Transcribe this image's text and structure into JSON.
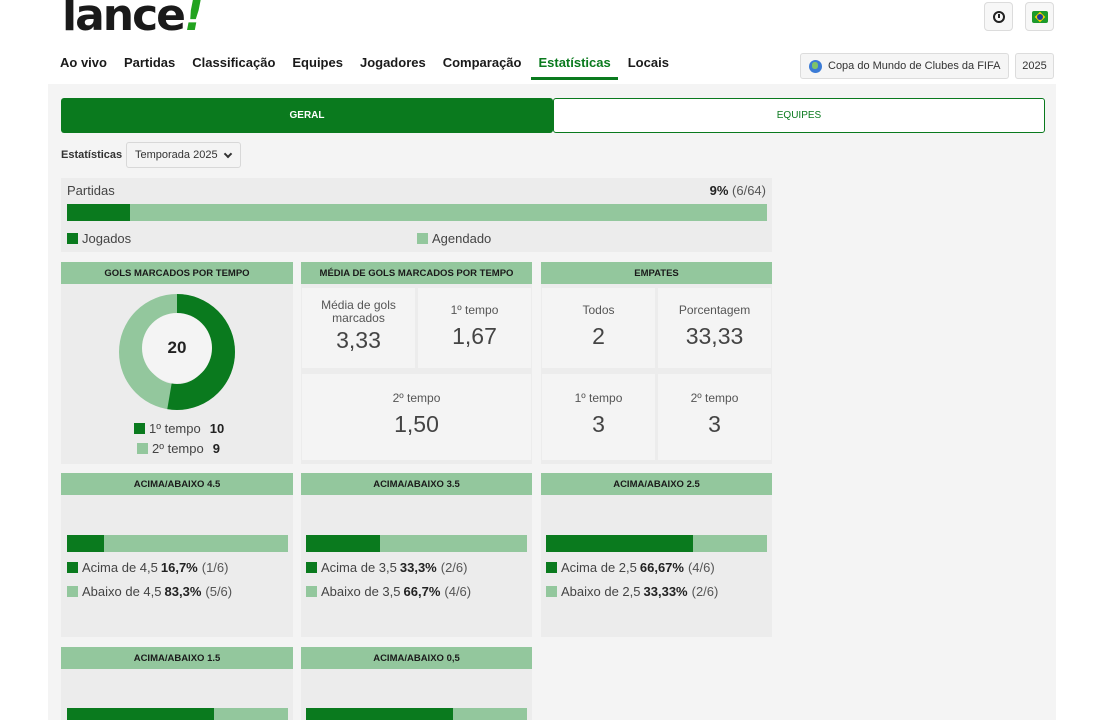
{
  "brand": {
    "logo_text": "lance",
    "logo_mark": "!"
  },
  "header_icons": [
    "clock-icon",
    "brazil-flag-icon"
  ],
  "nav": [
    {
      "label": "Ao vivo"
    },
    {
      "label": "Partidas"
    },
    {
      "label": "Classificação"
    },
    {
      "label": "Equipes"
    },
    {
      "label": "Jogadores"
    },
    {
      "label": "Comparação"
    },
    {
      "label": "Estatísticas",
      "active": true
    },
    {
      "label": "Locais"
    }
  ],
  "competition": {
    "label": "Copa do Mundo de Clubes da FIFA",
    "icon": "globe-icon",
    "year": "2025"
  },
  "tabs": {
    "geral": "GERAL",
    "equipes": "EQUIPES"
  },
  "filter": {
    "label": "Estatísticas",
    "selected": "Temporada 2025"
  },
  "partidas": {
    "title": "Partidas",
    "percent": "9%",
    "count": "(6/64)",
    "played_fraction": 0.09,
    "legend_played": "Jogados",
    "legend_scheduled": "Agendado"
  },
  "gols_por_tempo": {
    "title": "GOLS MARCADOS POR TEMPO",
    "total": "20",
    "first_label": "1º tempo",
    "first_value": "10",
    "second_label": "2º tempo",
    "second_value": "9",
    "first_fraction": 0.526
  },
  "media_gols": {
    "title": "MÉDIA DE GOLS MARCADOS POR TEMPO",
    "media_label": "Média de gols marcados",
    "media_value": "3,33",
    "first_label": "1º tempo",
    "first_value": "1,67",
    "second_label": "2º tempo",
    "second_value": "1,50"
  },
  "empates": {
    "title": "EMPATES",
    "todos_label": "Todos",
    "todos_value": "2",
    "pct_label": "Porcentagem",
    "pct_value": "33,33",
    "first_label": "1º tempo",
    "first_value": "3",
    "second_label": "2º tempo",
    "second_value": "3"
  },
  "over_under": [
    {
      "title": "ACIMA/ABAIXO 4.5",
      "above_label": "Acima de 4,5",
      "above_pct": "16,7%",
      "above_count": "(1/6)",
      "below_label": "Abaixo de 4,5",
      "below_pct": "83,3%",
      "below_count": "(5/6)",
      "fraction": 0.167
    },
    {
      "title": "ACIMA/ABAIXO 3.5",
      "above_label": "Acima de 3,5",
      "above_pct": "33,3%",
      "above_count": "(2/6)",
      "below_label": "Abaixo de 3,5",
      "below_pct": "66,7%",
      "below_count": "(4/6)",
      "fraction": 0.333
    },
    {
      "title": "ACIMA/ABAIXO 2.5",
      "above_label": "Acima de 2,5",
      "above_pct": "66,67%",
      "above_count": "(4/6)",
      "below_label": "Abaixo de 2,5",
      "below_pct": "33,33%",
      "below_count": "(2/6)",
      "fraction": 0.6667
    },
    {
      "title": "ACIMA/ABAIXO 1.5",
      "fraction": 0.667
    },
    {
      "title": "ACIMA/ABAIXO 0,5",
      "fraction": 0.667
    }
  ]
}
